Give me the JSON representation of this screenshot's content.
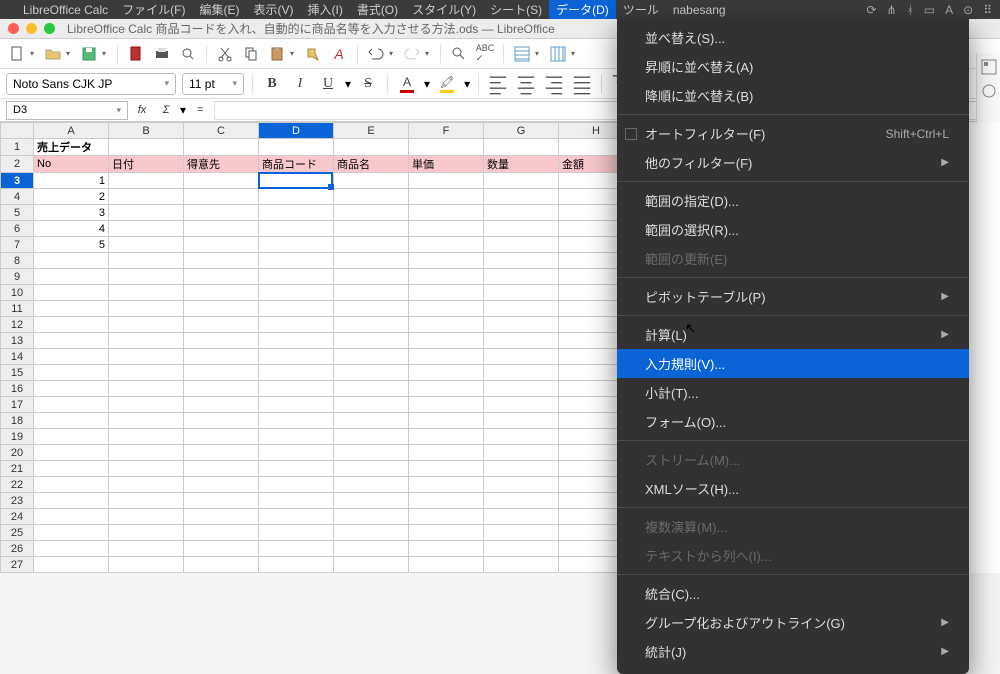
{
  "menubar": {
    "app": "LibreOffice Calc",
    "items": [
      "ファイル(F)",
      "編集(E)",
      "表示(V)",
      "挿入(I)",
      "書式(O)",
      "スタイル(Y)",
      "シート(S)",
      "データ(D)",
      "ツール",
      "nabesang"
    ],
    "active_index": 7
  },
  "window": {
    "title": "LibreOffice Calc 商品コードを入れ、自動的に商品名等を入力させる方法.ods — LibreOffice"
  },
  "font": {
    "name": "Noto Sans CJK JP",
    "size": "11 pt"
  },
  "formula": {
    "cell_ref": "D3",
    "fx": "fx",
    "sigma": "Σ",
    "eq": "="
  },
  "columns": [
    "A",
    "B",
    "C",
    "D",
    "E",
    "F",
    "G",
    "H"
  ],
  "rows": [
    "1",
    "2",
    "3",
    "4",
    "5",
    "6",
    "7",
    "8",
    "9",
    "10",
    "11",
    "12",
    "13",
    "14",
    "15",
    "16",
    "17",
    "18",
    "19",
    "20",
    "21",
    "22",
    "23",
    "24",
    "25",
    "26",
    "27"
  ],
  "selected_col_index": 3,
  "selected_row_index": 2,
  "cells": {
    "title": "売上データ",
    "headers": [
      "No",
      "日付",
      "得意先",
      "商品コード",
      "商品名",
      "単価",
      "数量",
      "金額"
    ],
    "nos": [
      "1",
      "2",
      "3",
      "4",
      "5"
    ]
  },
  "ctx": {
    "items": [
      {
        "label": "並べ替え(S)...",
        "type": "item"
      },
      {
        "label": "昇順に並べ替え(A)",
        "type": "item"
      },
      {
        "label": "降順に並べ替え(B)",
        "type": "item"
      },
      {
        "type": "sep"
      },
      {
        "label": "オートフィルター(F)",
        "type": "check",
        "shortcut": "Shift+Ctrl+L"
      },
      {
        "label": "他のフィルター(F)",
        "type": "submenu"
      },
      {
        "type": "sep"
      },
      {
        "label": "範囲の指定(D)...",
        "type": "item"
      },
      {
        "label": "範囲の選択(R)...",
        "type": "item"
      },
      {
        "label": "範囲の更新(E)",
        "type": "item",
        "disabled": true
      },
      {
        "type": "sep"
      },
      {
        "label": "ピボットテーブル(P)",
        "type": "submenu"
      },
      {
        "type": "sep"
      },
      {
        "label": "計算(L)",
        "type": "submenu"
      },
      {
        "label": "入力規則(V)...",
        "type": "item",
        "hover": true
      },
      {
        "label": "小計(T)...",
        "type": "item"
      },
      {
        "label": "フォーム(O)...",
        "type": "item"
      },
      {
        "type": "sep"
      },
      {
        "label": "ストリーム(M)...",
        "type": "item",
        "disabled": true
      },
      {
        "label": "XMLソース(H)...",
        "type": "item"
      },
      {
        "type": "sep"
      },
      {
        "label": "複数演算(M)...",
        "type": "item",
        "disabled": true
      },
      {
        "label": "テキストから列へ(I)...",
        "type": "item",
        "disabled": true
      },
      {
        "type": "sep"
      },
      {
        "label": "統合(C)...",
        "type": "item"
      },
      {
        "label": "グループ化およびアウトライン(G)",
        "type": "submenu"
      },
      {
        "label": "統計(J)",
        "type": "submenu"
      }
    ]
  }
}
